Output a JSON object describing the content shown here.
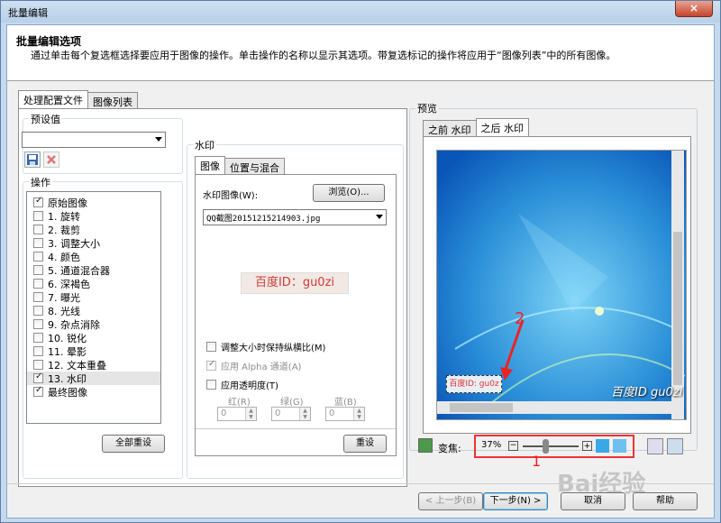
{
  "window": {
    "title": "批量编辑",
    "close_glyph": "×"
  },
  "header": {
    "title": "批量编辑选项",
    "description": "通过单击每个复选框选择要应用于图像的操作。单击操作的名称以显示其选项。带复选标记的操作将应用于“图像列表”中的所有图像。"
  },
  "left_tabs": [
    "处理配置文件",
    "图像列表"
  ],
  "presets": {
    "label": "预设值",
    "value": ""
  },
  "ops": {
    "label": "操作",
    "items": [
      {
        "label": "原始图像",
        "checked": true
      },
      {
        "label": "1.  旋转",
        "checked": false
      },
      {
        "label": "2.  裁剪",
        "checked": false
      },
      {
        "label": "3.  调整大小",
        "checked": false
      },
      {
        "label": "4.  颜色",
        "checked": false
      },
      {
        "label": "5.  通道混合器",
        "checked": false
      },
      {
        "label": "6.  深褐色",
        "checked": false
      },
      {
        "label": "7.  曝光",
        "checked": false
      },
      {
        "label": "8.  光线",
        "checked": false
      },
      {
        "label": "9.  杂点消除",
        "checked": false
      },
      {
        "label": "10.  锐化",
        "checked": false
      },
      {
        "label": "11.  晕影",
        "checked": false
      },
      {
        "label": "12.  文本重叠",
        "checked": false
      },
      {
        "label": "13.  水印",
        "checked": true,
        "selected": true
      },
      {
        "label": "最终图像",
        "checked": true
      }
    ],
    "reset_all": "全部重设"
  },
  "watermark": {
    "group_label": "水印",
    "tabs": [
      "图像",
      "位置与混合"
    ],
    "image_label": "水印图像(W):",
    "browse": "浏览(O)...",
    "file": "QQ截图20151215214903.jpg",
    "preview_text": "百度ID：gu0zi",
    "keep_ratio": "调整大小时保持纵横比(M)",
    "use_alpha": "应用 Alpha 通道(A)",
    "use_opacity": "应用透明度(T)",
    "red": "红(R)",
    "green": "绿(G)",
    "blue": "蓝(B)",
    "red_val": "0",
    "green_val": "0",
    "blue_val": "0",
    "reset": "重设"
  },
  "preview": {
    "label": "预览",
    "tabs": [
      "之前 水印",
      "之后 水印"
    ],
    "zoom_label": "变焦:",
    "zoom": "37%",
    "wm_text": "百度ID: gu0z",
    "big_wm": "百度ID gu0zi",
    "anno1": "1",
    "anno2": "2"
  },
  "footer": {
    "prev": "< 上一步(B)",
    "next": "下一步(N) >",
    "cancel": "取消",
    "help": "帮助",
    "brand": "Bai经验"
  }
}
